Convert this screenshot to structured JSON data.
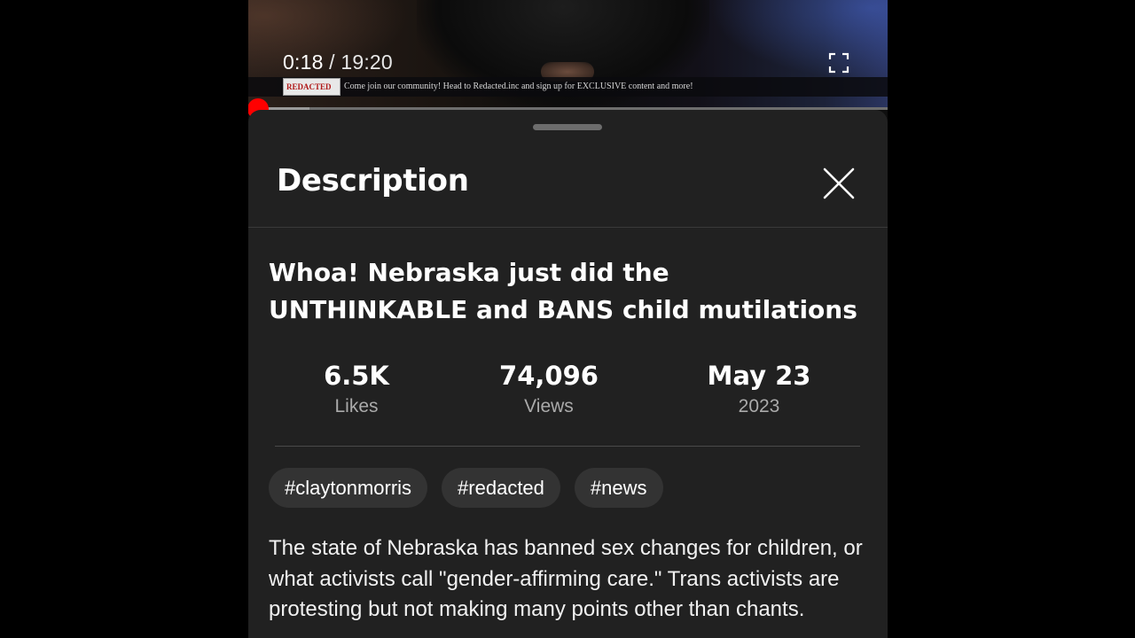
{
  "player": {
    "current_time": "0:18",
    "separator": "/",
    "total_time": "19:20",
    "progress_fraction": 0.0155,
    "buffered_fraction": 0.096,
    "ticker": {
      "logo_text": "REDACTED",
      "message": "Come join our community! Head to Redacted.inc and sign up for EXCLUSIVE content and more!"
    }
  },
  "icons": {
    "fullscreen": "fullscreen-icon",
    "close": "close-icon"
  },
  "colors": {
    "progress": "#ff0000",
    "sheet_bg": "#212121",
    "chip_bg": "#333333",
    "secondary_text": "#aaaaaa"
  },
  "sheet": {
    "title": "Description",
    "video_title": "Whoa! Nebraska just did the UNTHINKABLE and BANS child mutilations",
    "stats": {
      "likes": {
        "value": "6.5K",
        "label": "Likes"
      },
      "views": {
        "value": "74,096",
        "label": "Views"
      },
      "date": {
        "value": "May 23",
        "label": "2023"
      }
    },
    "tags": [
      "#claytonmorris",
      "#redacted",
      "#news"
    ],
    "description": "The state of Nebraska has banned sex changes for children, or what activists call \"gender-affirming care.\" Trans activists are protesting but not making many points other than chants."
  }
}
